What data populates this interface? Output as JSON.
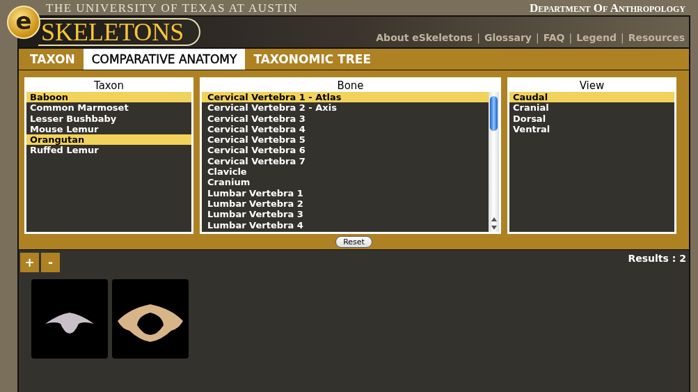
{
  "header": {
    "university": "THE UNIVERSITY OF TEXAS AT AUSTIN",
    "department": "Department Of Anthropology"
  },
  "logo": {
    "badge": "e",
    "text": "SKELETONS"
  },
  "nav": [
    {
      "kind": "link",
      "text": "About eSkeletons"
    },
    {
      "kind": "separator",
      "text": "|"
    },
    {
      "kind": "link",
      "text": "Glossary"
    },
    {
      "kind": "separator",
      "text": "|"
    },
    {
      "kind": "link",
      "text": "FAQ"
    },
    {
      "kind": "separator",
      "text": "|"
    },
    {
      "kind": "link",
      "text": "Legend"
    },
    {
      "kind": "separator",
      "text": "|"
    },
    {
      "kind": "link",
      "text": "Resources"
    }
  ],
  "tabs": [
    {
      "label": "TAXON",
      "selected": false
    },
    {
      "label": "COMPARATIVE ANATOMY",
      "selected": true
    },
    {
      "label": "TAXONOMIC TREE",
      "selected": false
    }
  ],
  "lists": [
    {
      "title": "Taxon",
      "scrollable": false,
      "items": [
        {
          "text": "Baboon",
          "selected": true
        },
        {
          "text": "Common Marmoset",
          "selected": false
        },
        {
          "text": "Lesser Bushbaby",
          "selected": false
        },
        {
          "text": "Mouse Lemur",
          "selected": false
        },
        {
          "text": "Orangutan",
          "selected": true
        },
        {
          "text": "Ruffed Lemur",
          "selected": false
        }
      ]
    },
    {
      "title": "Bone",
      "scrollable": true,
      "items": [
        {
          "text": "Cervical Vertebra 1 - Atlas",
          "selected": true
        },
        {
          "text": "Cervical Vertebra 2 - Axis",
          "selected": false
        },
        {
          "text": "Cervical Vertebra 3",
          "selected": false
        },
        {
          "text": "Cervical Vertebra 4",
          "selected": false
        },
        {
          "text": "Cervical Vertebra 5",
          "selected": false
        },
        {
          "text": "Cervical Vertebra 6",
          "selected": false
        },
        {
          "text": "Cervical Vertebra 7",
          "selected": false
        },
        {
          "text": "Clavicle",
          "selected": false
        },
        {
          "text": "Cranium",
          "selected": false
        },
        {
          "text": "Lumbar Vertebra 1",
          "selected": false
        },
        {
          "text": "Lumbar Vertebra 2",
          "selected": false
        },
        {
          "text": "Lumbar Vertebra 3",
          "selected": false
        },
        {
          "text": "Lumbar Vertebra 4",
          "selected": false
        }
      ]
    },
    {
      "title": "View",
      "scrollable": false,
      "items": [
        {
          "text": "Caudal",
          "selected": true
        },
        {
          "text": "Cranial",
          "selected": false
        },
        {
          "text": "Dorsal",
          "selected": false
        },
        {
          "text": "Ventral",
          "selected": false
        }
      ]
    }
  ],
  "reset": "Reset",
  "zoom_buttons": [
    "+",
    "-"
  ],
  "results": "Results : 2",
  "thumbnails": [
    {
      "kind": "small"
    },
    {
      "kind": "large"
    }
  ]
}
